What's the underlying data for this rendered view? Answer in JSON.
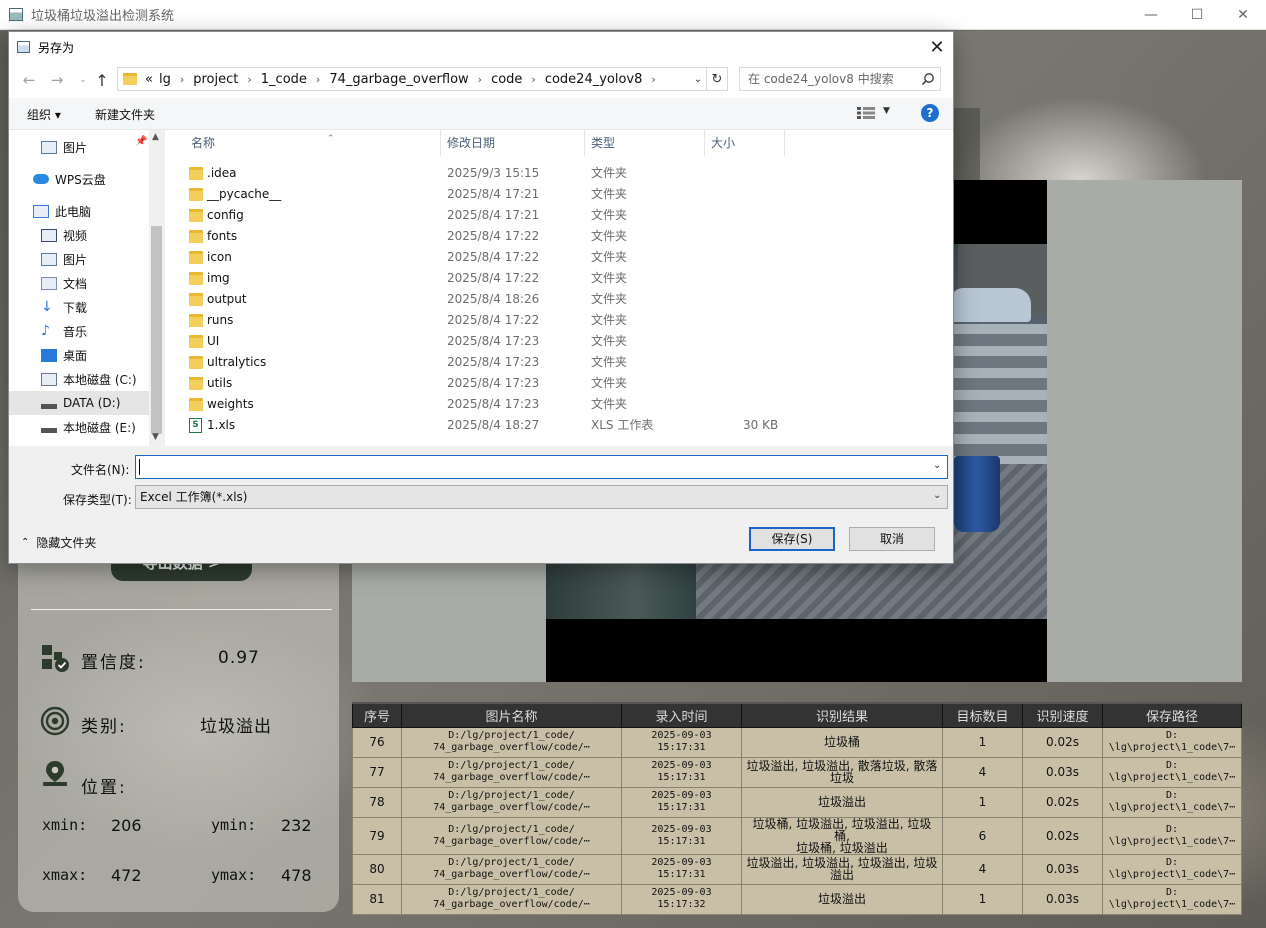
{
  "app": {
    "title": "垃圾桶垃圾溢出检测系统",
    "export_button": "导出数据 >",
    "confidence": {
      "label": "置信度:",
      "value": "0.97"
    },
    "category": {
      "label": "类别:",
      "value": "垃圾溢出"
    },
    "position": {
      "label": "位置:"
    },
    "coords": {
      "xmin_label": "xmin:",
      "xmin": "206",
      "ymin_label": "ymin:",
      "ymin": "232",
      "xmax_label": "xmax:",
      "xmax": "472",
      "ymax_label": "ymax:",
      "ymax": "478"
    },
    "table": {
      "headers": [
        "序号",
        "图片名称",
        "录入时间",
        "识别结果",
        "目标数目",
        "识别速度",
        "保存路径"
      ],
      "rows": [
        {
          "id": "76",
          "name": "D:/lg/project/1_code/\n74_garbage_overflow/code/⋯",
          "time": "2025-09-03\n15:17:31",
          "result": "垃圾桶",
          "count": "1",
          "speed": "0.02s",
          "path": "D:\n\\lg\\project\\1_code\\7⋯"
        },
        {
          "id": "77",
          "name": "D:/lg/project/1_code/\n74_garbage_overflow/code/⋯",
          "time": "2025-09-03\n15:17:31",
          "result": "垃圾溢出, 垃圾溢出, 散落垃圾, 散落\n垃圾",
          "count": "4",
          "speed": "0.03s",
          "path": "D:\n\\lg\\project\\1_code\\7⋯"
        },
        {
          "id": "78",
          "name": "D:/lg/project/1_code/\n74_garbage_overflow/code/⋯",
          "time": "2025-09-03\n15:17:31",
          "result": "垃圾溢出",
          "count": "1",
          "speed": "0.02s",
          "path": "D:\n\\lg\\project\\1_code\\7⋯"
        },
        {
          "id": "79",
          "name": "D:/lg/project/1_code/\n74_garbage_overflow/code/⋯",
          "time": "2025-09-03\n15:17:31",
          "result": "垃圾桶, 垃圾溢出, 垃圾溢出, 垃圾桶,\n垃圾桶, 垃圾溢出",
          "count": "6",
          "speed": "0.02s",
          "path": "D:\n\\lg\\project\\1_code\\7⋯"
        },
        {
          "id": "80",
          "name": "D:/lg/project/1_code/\n74_garbage_overflow/code/⋯",
          "time": "2025-09-03\n15:17:31",
          "result": "垃圾溢出, 垃圾溢出, 垃圾溢出, 垃圾\n溢出",
          "count": "4",
          "speed": "0.03s",
          "path": "D:\n\\lg\\project\\1_code\\7⋯"
        },
        {
          "id": "81",
          "name": "D:/lg/project/1_code/\n74_garbage_overflow/code/⋯",
          "time": "2025-09-03\n15:17:32",
          "result": "垃圾溢出",
          "count": "1",
          "speed": "0.03s",
          "path": "D:\n\\lg\\project\\1_code\\7⋯"
        }
      ]
    }
  },
  "dialog": {
    "title": "另存为",
    "breadcrumb": [
      "«",
      "lg",
      "project",
      "1_code",
      "74_garbage_overflow",
      "code",
      "code24_yolov8"
    ],
    "search_placeholder": "在 code24_yolov8 中搜索",
    "toolbar": {
      "organize": "组织 ▾",
      "new_folder": "新建文件夹",
      "help": "?"
    },
    "sidebar": [
      {
        "label": "图片",
        "icon": "pictures-icon"
      },
      {
        "label": "WPS云盘",
        "icon": "cloud-icon"
      },
      {
        "label": "此电脑",
        "icon": "computer-icon"
      },
      {
        "label": "视频",
        "icon": "video-icon"
      },
      {
        "label": "图片",
        "icon": "pictures-icon"
      },
      {
        "label": "文档",
        "icon": "document-icon"
      },
      {
        "label": "下载",
        "icon": "download-icon"
      },
      {
        "label": "音乐",
        "icon": "music-icon"
      },
      {
        "label": "桌面",
        "icon": "desktop-icon"
      },
      {
        "label": "本地磁盘 (C:)",
        "icon": "drive-c-icon"
      },
      {
        "label": "DATA (D:)",
        "icon": "drive-icon"
      },
      {
        "label": "本地磁盘 (E:)",
        "icon": "drive-icon"
      }
    ],
    "columns": [
      "名称",
      "修改日期",
      "类型",
      "大小"
    ],
    "files": [
      {
        "name": ".idea",
        "date": "2025/9/3 15:15",
        "type": "文件夹",
        "size": "",
        "kind": "folder"
      },
      {
        "name": "__pycache__",
        "date": "2025/8/4 17:21",
        "type": "文件夹",
        "size": "",
        "kind": "folder"
      },
      {
        "name": "config",
        "date": "2025/8/4 17:21",
        "type": "文件夹",
        "size": "",
        "kind": "folder"
      },
      {
        "name": "fonts",
        "date": "2025/8/4 17:22",
        "type": "文件夹",
        "size": "",
        "kind": "folder"
      },
      {
        "name": "icon",
        "date": "2025/8/4 17:22",
        "type": "文件夹",
        "size": "",
        "kind": "folder"
      },
      {
        "name": "img",
        "date": "2025/8/4 17:22",
        "type": "文件夹",
        "size": "",
        "kind": "folder"
      },
      {
        "name": "output",
        "date": "2025/8/4 18:26",
        "type": "文件夹",
        "size": "",
        "kind": "folder"
      },
      {
        "name": "runs",
        "date": "2025/8/4 17:22",
        "type": "文件夹",
        "size": "",
        "kind": "folder"
      },
      {
        "name": "UI",
        "date": "2025/8/4 17:23",
        "type": "文件夹",
        "size": "",
        "kind": "folder"
      },
      {
        "name": "ultralytics",
        "date": "2025/8/4 17:23",
        "type": "文件夹",
        "size": "",
        "kind": "folder"
      },
      {
        "name": "utils",
        "date": "2025/8/4 17:23",
        "type": "文件夹",
        "size": "",
        "kind": "folder"
      },
      {
        "name": "weights",
        "date": "2025/8/4 17:23",
        "type": "文件夹",
        "size": "",
        "kind": "folder"
      },
      {
        "name": "1.xls",
        "date": "2025/8/4 18:27",
        "type": "XLS 工作表",
        "size": "30 KB",
        "kind": "xls"
      }
    ],
    "filename_label": "文件名(N):",
    "filename_value": "",
    "filetype_label": "保存类型(T):",
    "filetype_value": "Excel 工作簿(*.xls)",
    "hide_folders": "隐藏文件夹",
    "save_button": "保存(S)",
    "cancel_button": "取消"
  }
}
